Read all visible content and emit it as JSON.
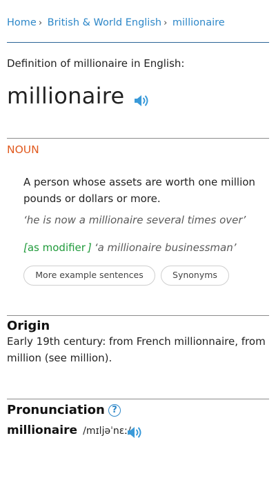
{
  "breadcrumb": {
    "home": "Home",
    "section": "British & World English",
    "current": "millionaire",
    "separator": "›"
  },
  "entry": {
    "definition_of": "Definition of millionaire in English:",
    "headword": "millionaire",
    "pos": "NOUN",
    "definition": "A person whose assets are worth one million pounds or dollars or more.",
    "example": "‘he is now a millionaire several times over’",
    "modifier": {
      "open": "[",
      "label": "as modifier",
      "close": "]",
      "example": "‘a millionaire businessman’"
    },
    "buttons": {
      "more_examples": "More example sentences",
      "synonyms": "Synonyms"
    }
  },
  "origin": {
    "heading": "Origin",
    "text": "Early 19th century: from French millionnaire, from million (see million)."
  },
  "pronunciation": {
    "heading": "Pronunciation",
    "help": "?",
    "word": "millionaire",
    "ipa": "/mɪljəˈnɛː/"
  },
  "colors": {
    "link": "#2d87c8",
    "pos": "#e15a1f",
    "modifier": "#1f9a3a",
    "speaker": "#3a9ad9"
  },
  "icons": {
    "speaker": "speaker-icon",
    "help": "help-icon"
  }
}
